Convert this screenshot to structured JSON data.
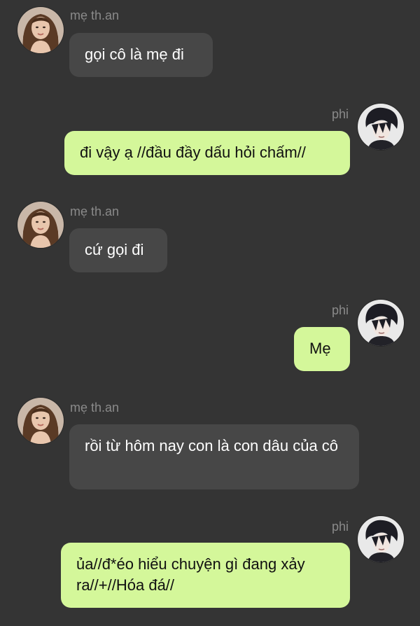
{
  "messages": [
    {
      "sender": "mẹ th.an",
      "side": "in",
      "text": "gọi cô là mẹ đi"
    },
    {
      "sender": "phi",
      "side": "out",
      "text": "đi vậy ạ //đầu đầy dấu hỏi chấm//"
    },
    {
      "sender": "mẹ th.an",
      "side": "in",
      "text": "cứ gọi đi"
    },
    {
      "sender": "phi",
      "side": "out",
      "text": "Mẹ"
    },
    {
      "sender": "mẹ th.an",
      "side": "in",
      "text": "rồi từ hôm nay con là con dâu của cô"
    },
    {
      "sender": "phi",
      "side": "out",
      "text": "ủa//đ*éo hiểu chuyện gì đang xảy ra//+//Hóa đá//"
    }
  ],
  "colors": {
    "background": "#343434",
    "incoming_bubble": "#474747",
    "outgoing_bubble": "#d4f79a",
    "name_text": "#8a8a8a"
  }
}
